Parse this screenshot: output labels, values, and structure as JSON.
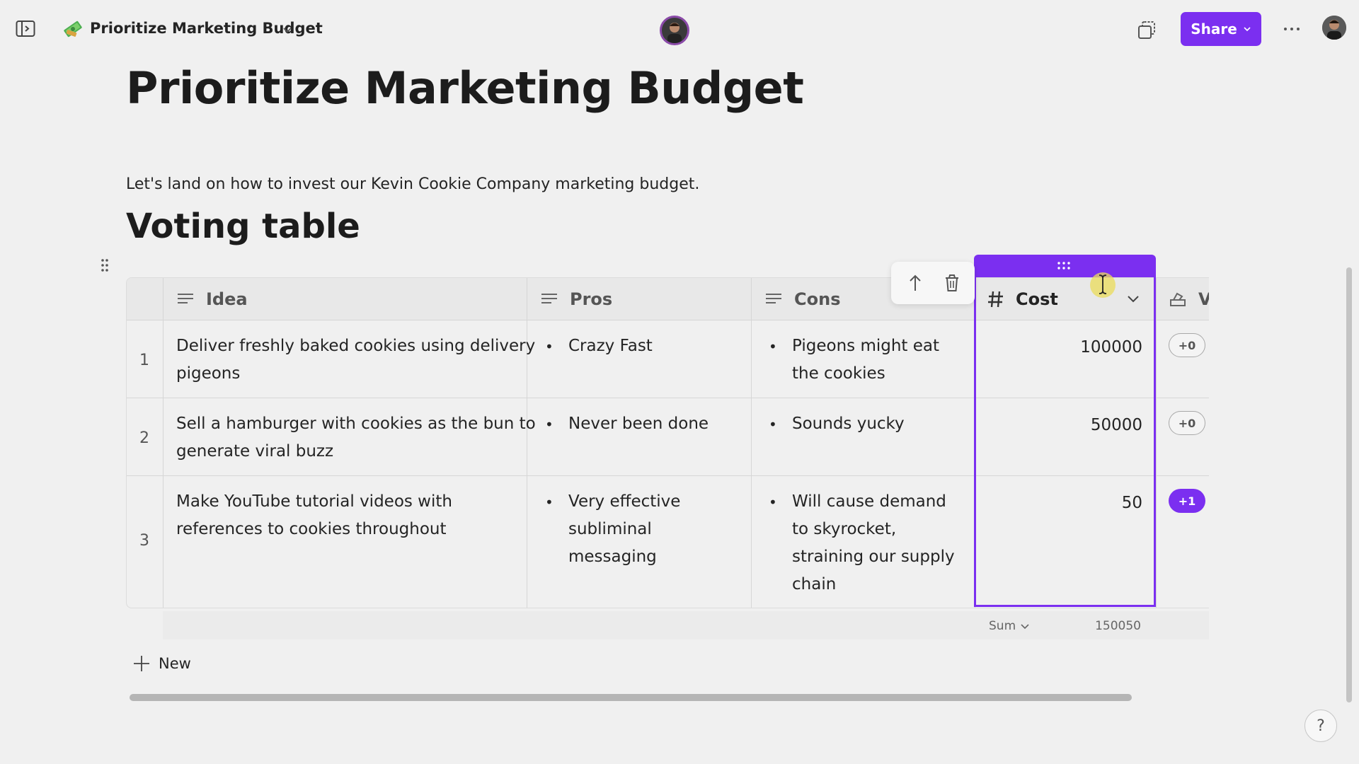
{
  "header": {
    "doc_title": "Prioritize Marketing Budget",
    "share_label": "Share"
  },
  "content": {
    "page_title": "Prioritize Marketing Budget",
    "description": "Let's land on how to invest our Kevin Cookie Company marketing budget.",
    "section_heading": "Voting table"
  },
  "table": {
    "columns": [
      {
        "label": "Idea",
        "icon": "text-lines-icon"
      },
      {
        "label": "Pros",
        "icon": "text-lines-icon"
      },
      {
        "label": "Cons",
        "icon": "text-lines-icon"
      },
      {
        "label": "Cost",
        "icon": "hash-icon"
      },
      {
        "label": "Vo",
        "icon": "vote-icon"
      }
    ],
    "rows": [
      {
        "num": "1",
        "idea": [
          "Deliver freshly baked cookies using delivery",
          "pigeons"
        ],
        "pros": [
          "Crazy Fast"
        ],
        "cons": [
          "Pigeons might eat",
          "the cookies"
        ],
        "cost": "100000",
        "vote": "+0"
      },
      {
        "num": "2",
        "idea": [
          "Sell a hamburger with cookies as the bun to",
          "generate viral buzz"
        ],
        "pros": [
          "Never been done"
        ],
        "cons": [
          "Sounds yucky"
        ],
        "cost": "50000",
        "vote": "+0"
      },
      {
        "num": "3",
        "idea": [
          "Make YouTube tutorial videos with",
          "references to cookies throughout"
        ],
        "pros": [
          "Very effective",
          "subliminal",
          "messaging"
        ],
        "cons": [
          "Will cause demand",
          "to skyrocket,",
          "straining our supply",
          "chain"
        ],
        "cost": "50",
        "vote": "+1"
      }
    ],
    "sum_label": "Sum",
    "sum_value": "150050"
  },
  "footer": {
    "new_label": "New",
    "help_label": "?"
  },
  "colors": {
    "accent": "#7b2ff0",
    "background": "#f0f0f0"
  }
}
